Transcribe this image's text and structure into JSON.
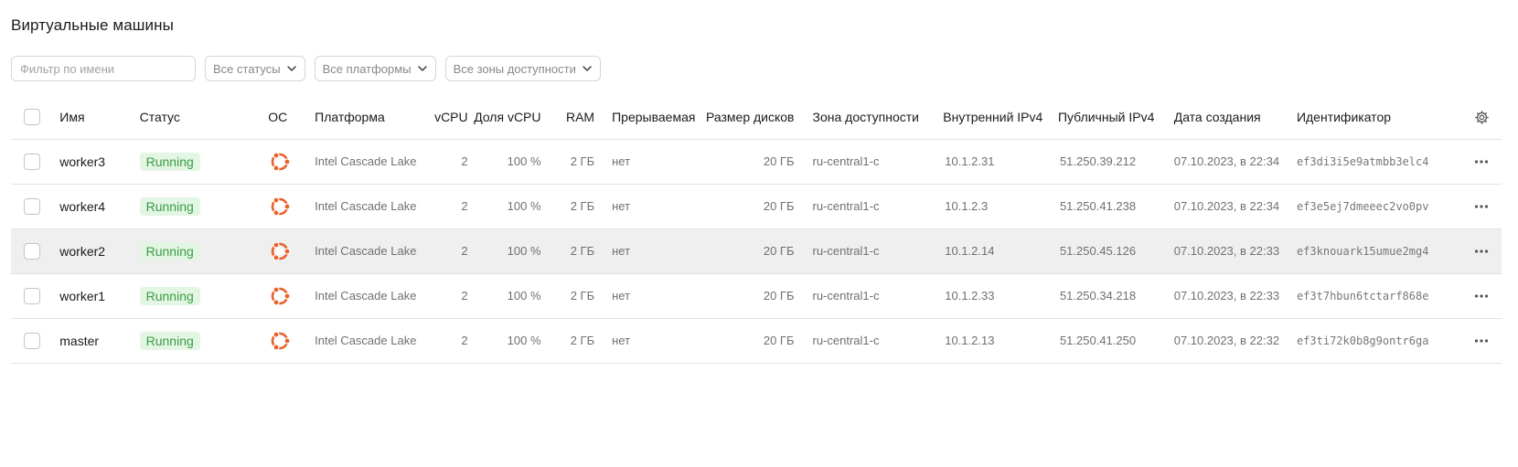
{
  "page": {
    "title": "Виртуальные машины"
  },
  "filters": {
    "name_placeholder": "Фильтр по имени",
    "status_label": "Все статусы",
    "platform_label": "Все платформы",
    "zone_label": "Все зоны доступности"
  },
  "table": {
    "columns": {
      "name": "Имя",
      "status": "Статус",
      "os": "ОС",
      "platform": "Платформа",
      "vcpu": "vCPU",
      "vcpu_share": "Доля vCPU",
      "ram": "RAM",
      "preemptible": "Прерываемая",
      "disk_size": "Размер дисков",
      "zone": "Зона доступности",
      "internal_ip": "Внутренний IPv4",
      "public_ip": "Публичный IPv4",
      "created": "Дата создания",
      "id": "Идентификатор"
    },
    "rows": [
      {
        "name": "worker3",
        "status": "Running",
        "os": "ubuntu-icon",
        "platform": "Intel Cascade Lake",
        "vcpu": "2",
        "vcpu_share": "100 %",
        "ram": "2 ГБ",
        "preemptible": "нет",
        "disk_size": "20 ГБ",
        "zone": "ru-central1-c",
        "internal_ip": "10.1.2.31",
        "public_ip": "51.250.39.212",
        "created": "07.10.2023, в 22:34",
        "id": "ef3di3i5e9atmbb3elc4"
      },
      {
        "name": "worker4",
        "status": "Running",
        "os": "ubuntu-icon",
        "platform": "Intel Cascade Lake",
        "vcpu": "2",
        "vcpu_share": "100 %",
        "ram": "2 ГБ",
        "preemptible": "нет",
        "disk_size": "20 ГБ",
        "zone": "ru-central1-c",
        "internal_ip": "10.1.2.3",
        "public_ip": "51.250.41.238",
        "created": "07.10.2023, в 22:34",
        "id": "ef3e5ej7dmeeec2vo0pv"
      },
      {
        "name": "worker2",
        "status": "Running",
        "os": "ubuntu-icon",
        "platform": "Intel Cascade Lake",
        "vcpu": "2",
        "vcpu_share": "100 %",
        "ram": "2 ГБ",
        "preemptible": "нет",
        "disk_size": "20 ГБ",
        "zone": "ru-central1-c",
        "internal_ip": "10.1.2.14",
        "public_ip": "51.250.45.126",
        "created": "07.10.2023, в 22:33",
        "id": "ef3knouark15umue2mg4"
      },
      {
        "name": "worker1",
        "status": "Running",
        "os": "ubuntu-icon",
        "platform": "Intel Cascade Lake",
        "vcpu": "2",
        "vcpu_share": "100 %",
        "ram": "2 ГБ",
        "preemptible": "нет",
        "disk_size": "20 ГБ",
        "zone": "ru-central1-c",
        "internal_ip": "10.1.2.33",
        "public_ip": "51.250.34.218",
        "created": "07.10.2023, в 22:33",
        "id": "ef3t7hbun6tctarf868e"
      },
      {
        "name": "master",
        "status": "Running",
        "os": "ubuntu-icon",
        "platform": "Intel Cascade Lake",
        "vcpu": "2",
        "vcpu_share": "100 %",
        "ram": "2 ГБ",
        "preemptible": "нет",
        "disk_size": "20 ГБ",
        "zone": "ru-central1-c",
        "internal_ip": "10.1.2.13",
        "public_ip": "51.250.41.250",
        "created": "07.10.2023, в 22:32",
        "id": "ef3ti72k0b8g9ontr6ga"
      }
    ]
  },
  "colors": {
    "status_running_bg": "#e3f5e3",
    "status_running_text": "#3a9d45",
    "ubuntu_orange": "#e9622b",
    "row_hover": "#efefef"
  }
}
